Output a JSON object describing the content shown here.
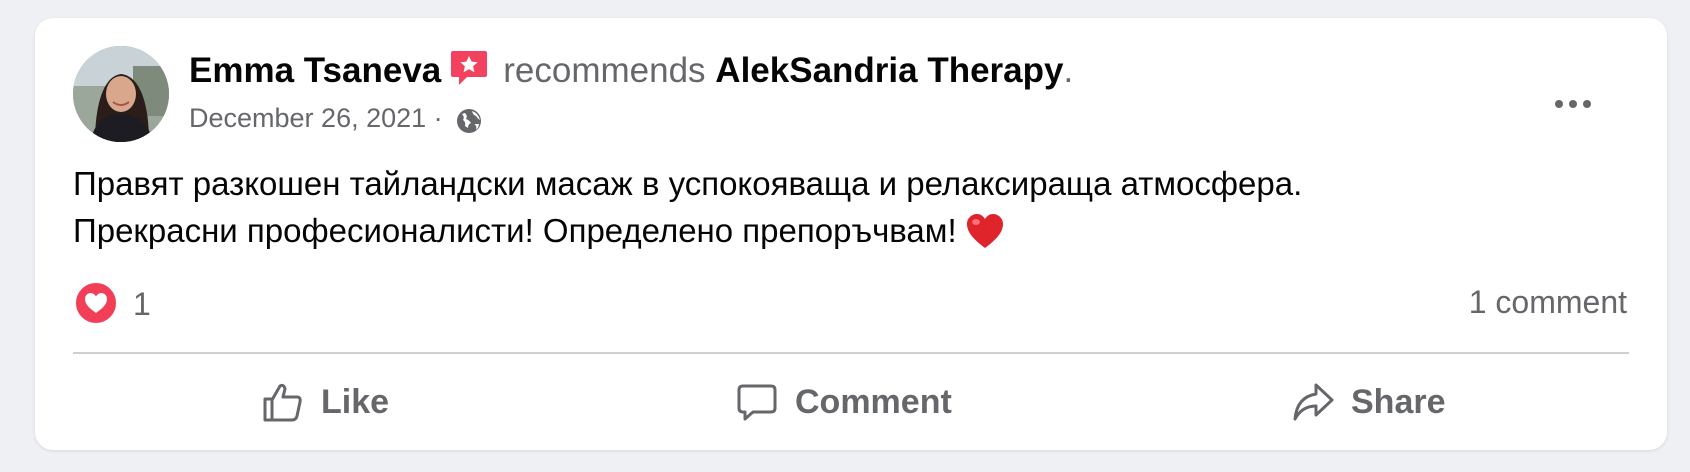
{
  "post": {
    "author": "Emma Tsaneva",
    "verb": "recommends",
    "page_name": "AlekSandria Therapy",
    "punctuation": ".",
    "date": "December 26, 2021",
    "date_separator": "·",
    "audience_icon": "globe-icon",
    "recommend_badge_icon": "star-speech-bubble-icon",
    "text_line_1": "Правят разкошен тайландски масаж в успокояваща и релаксираща атмосфера.",
    "text_line_2": "Прекрасни професионалисти! Определено препоръчвам!"
  },
  "reactions": {
    "icon": "love-reaction-icon",
    "count": "1"
  },
  "comments": {
    "count_label": "1 comment"
  },
  "actions": {
    "like_label": "Like",
    "comment_label": "Comment",
    "share_label": "Share"
  },
  "colors": {
    "card_background": "#ffffff",
    "page_background": "#eef0f4",
    "secondary_text": "#65676b",
    "primary_text": "#050505",
    "recommend_badge": "#f3425f",
    "love_reaction": "#f33e58"
  }
}
